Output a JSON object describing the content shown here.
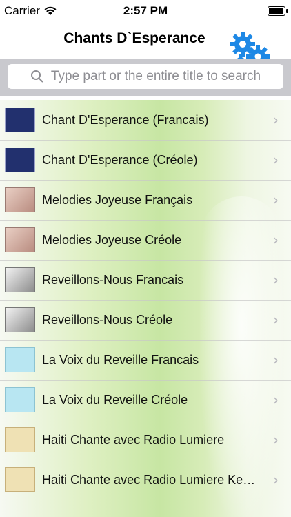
{
  "status": {
    "carrier": "Carrier",
    "time": "2:57 PM",
    "battery_level": 0.95
  },
  "header": {
    "title": "Chants D`Esperance",
    "settings_icon": "gears-icon",
    "gear_color": "#1e88e5"
  },
  "search": {
    "placeholder": "Type part or the entire title to search"
  },
  "list": {
    "items": [
      {
        "label": "Chant D'Esperance (Francais)",
        "thumb": "blue-book"
      },
      {
        "label": "Chant D'Esperance (Créole)",
        "thumb": "blue-book"
      },
      {
        "label": "Melodies Joyeuse Français",
        "thumb": "pink-book"
      },
      {
        "label": "Melodies Joyeuse Créole",
        "thumb": "pink-book"
      },
      {
        "label": "Reveillons-Nous Francais",
        "thumb": "gray-book"
      },
      {
        "label": "Reveillons-Nous Créole",
        "thumb": "gray-book"
      },
      {
        "label": "La Voix du Reveille Francais",
        "thumb": "cyan-book"
      },
      {
        "label": "La Voix du Reveille Créole",
        "thumb": "cyan-book"
      },
      {
        "label": "Haiti Chante avec Radio Lumiere",
        "thumb": "tan-book"
      },
      {
        "label": "Haiti Chante avec Radio Lumiere Ke…",
        "thumb": "tan-book"
      }
    ]
  }
}
